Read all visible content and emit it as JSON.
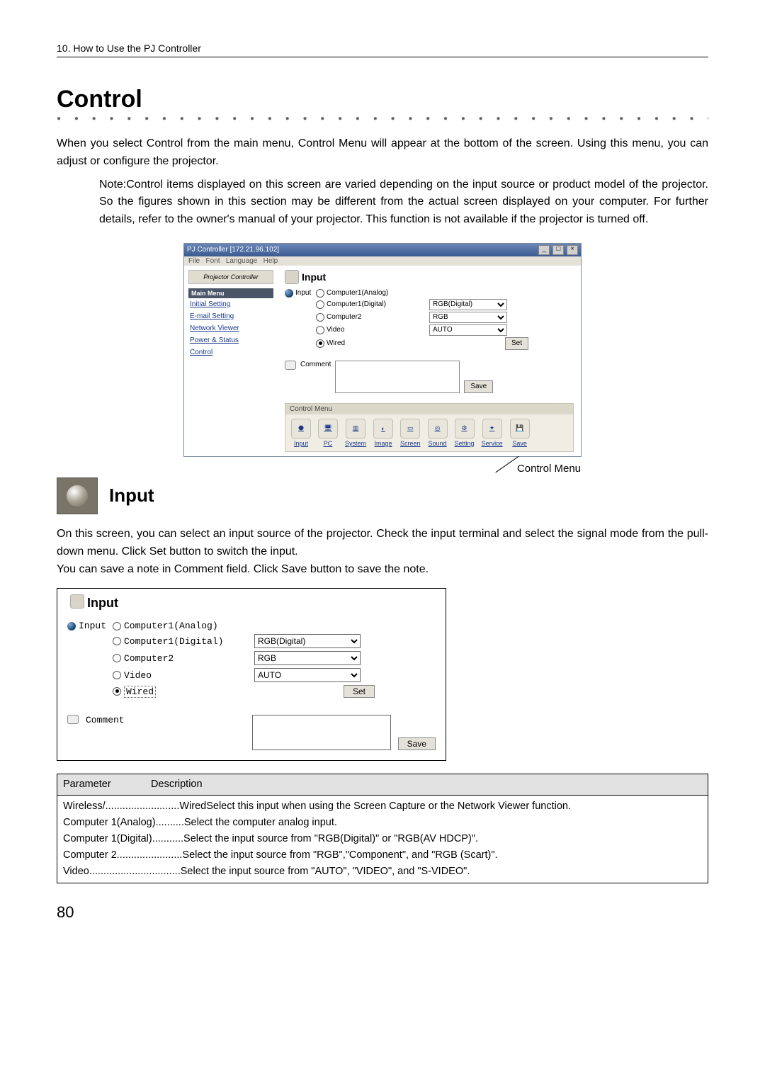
{
  "header": {
    "chapter": "10. How to Use the PJ Controller"
  },
  "section_title": "Control",
  "intro": "When you select Control from the main menu, Control Menu will appear at the bottom of the screen. Using this menu, you can adjust or configure the projector.",
  "note": "Note:Control items displayed on this screen are varied depending on the input source or product model of the projector. So the figures shown in this section may be different from the actual screen displayed on your computer. For further details, refer to the owner's manual of your projector. This function is not available if the projector is turned off.",
  "app": {
    "title": "PJ Controller [172.21.96.102]",
    "menus": [
      "File",
      "Font",
      "Language",
      "Help"
    ],
    "logo": "Projector Controller",
    "sidebar_header": "Main Menu",
    "sidebar_items": [
      "Initial Setting",
      "E-mail Setting",
      "Network Viewer",
      "Power & Status",
      "Control"
    ],
    "pane_title": "Input",
    "radios": [
      {
        "label": "Computer1(Analog)",
        "sel": ""
      },
      {
        "label": "Computer1(Digital)",
        "sel": "RGB(Digital)"
      },
      {
        "label": "Computer2",
        "sel": "RGB"
      },
      {
        "label": "Video",
        "sel": "AUTO"
      },
      {
        "label": "Wired",
        "sel": ""
      }
    ],
    "input_label": "Input",
    "set_btn": "Set",
    "comment_label": "Comment",
    "save_btn": "Save",
    "cm_header": "Control Menu",
    "cm_items": [
      "Input",
      "PC",
      "System",
      "Image",
      "Screen",
      "Sound",
      "Setting",
      "Service",
      "Save"
    ]
  },
  "cm_callout": "Control Menu",
  "input_heading": "Input",
  "subintro": "On this screen, you can select an input source of the projector. Check the input terminal and select the signal mode from the pull-down menu. Click Set button to switch the input.\nYou can save a note in Comment field. Click Save button to save the note.",
  "panel": {
    "title": "Input",
    "input_label": "Input",
    "rows": [
      {
        "label": "Computer1(Analog)",
        "sel": "",
        "checked": false
      },
      {
        "label": "Computer1(Digital)",
        "sel": "RGB(Digital)",
        "checked": false
      },
      {
        "label": "Computer2",
        "sel": "RGB",
        "checked": false
      },
      {
        "label": "Video",
        "sel": "AUTO",
        "checked": false
      },
      {
        "label": "Wired",
        "sel": "",
        "checked": true
      }
    ],
    "set_btn": "Set",
    "comment_label": "Comment",
    "save_btn": "Save"
  },
  "param_table": {
    "h1": "Parameter",
    "h2": "Description",
    "rows": [
      "Wireless/..........................WiredSelect this input when using the Screen Capture or the Network Viewer function.",
      "Computer 1(Analog)..........Select the computer analog input.",
      "Computer 1(Digital)...........Select the input source from \"RGB(Digital)\" or \"RGB(AV HDCP)\".",
      "Computer 2.......................Select the input source from \"RGB\",\"Component\", and \"RGB (Scart)\".",
      "Video................................Select the input source from \"AUTO\", \"VIDEO\", and \"S-VIDEO\"."
    ]
  },
  "page_number": "80"
}
